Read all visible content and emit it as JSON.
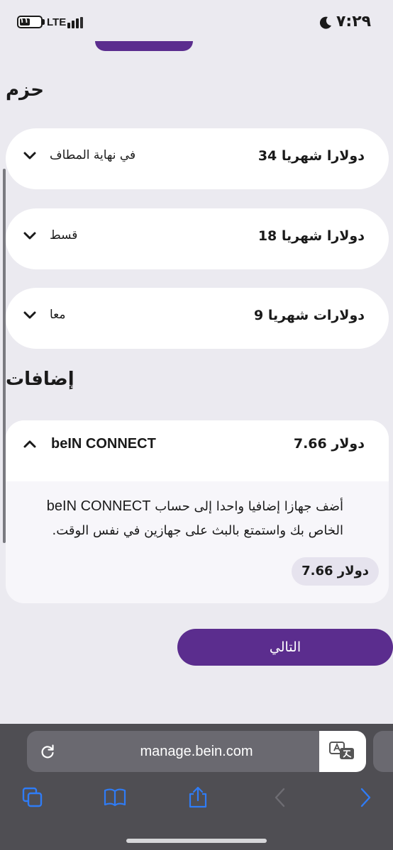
{
  "status_bar": {
    "battery_level": "١١",
    "network": "LTE",
    "time": "٧:٢٩"
  },
  "packs": {
    "title": "حزم",
    "items": [
      {
        "price": "دولارا شهريا 34",
        "name": "في نهاية المطاف",
        "expanded": false
      },
      {
        "price": "دولارا شهريا 18",
        "name": "قسط",
        "expanded": false
      },
      {
        "price": "دولارات شهريا 9",
        "name": "معا",
        "expanded": false
      }
    ]
  },
  "addons": {
    "title": "إضافات",
    "item": {
      "name": "beIN CONNECT",
      "price": "دولار 7.66",
      "expanded": true,
      "description_prefix": "أضف جهازا إضافيا واحدا إلى حساب ",
      "description_brand": "beIN CONNECT",
      "description_suffix": " الخاص بك واستمتع بالبث على جهازين في نفس الوقت.",
      "price_badge": "دولار 7.66"
    }
  },
  "next_button": {
    "label": "التالي"
  },
  "browser": {
    "url": "manage.bein.com",
    "toolbar": [
      "tabs-icon",
      "bookmarks-icon",
      "share-icon",
      "back-icon",
      "forward-icon"
    ]
  },
  "colors": {
    "accent": "#5b2d8e",
    "background": "#ebeaf0",
    "card": "#ffffff",
    "browser_bar": "#4f4e53",
    "link_blue": "#2f7cf6"
  }
}
